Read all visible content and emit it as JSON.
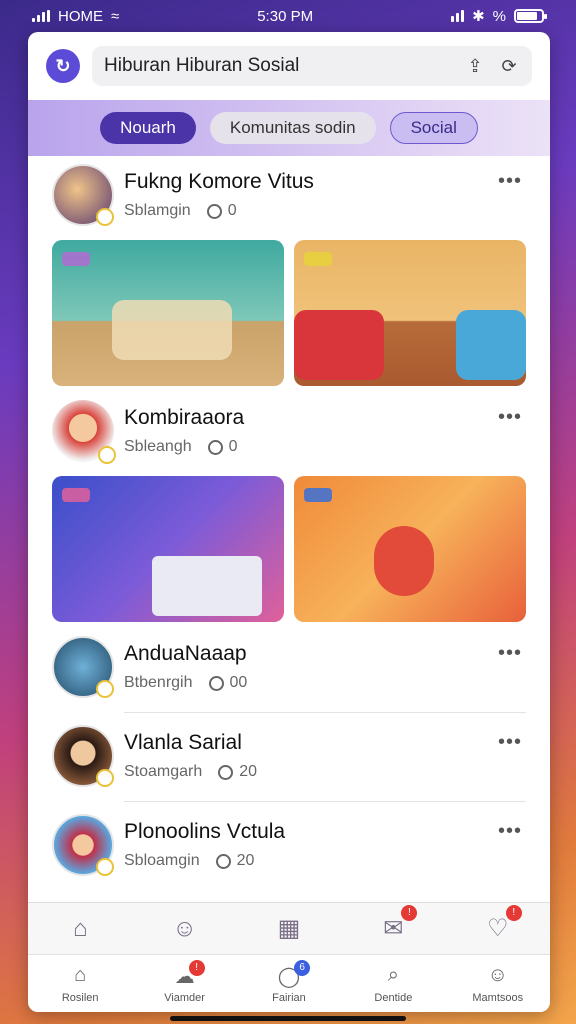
{
  "status": {
    "carrier": "HOME",
    "time": "5:30 PM",
    "battery_icon": "battery-icon"
  },
  "top_bar": {
    "title": "Hiburan Hiburan Sosial"
  },
  "tabs": [
    {
      "label": "Nouarh"
    },
    {
      "label": "Komunitas sodin"
    },
    {
      "label": "Social"
    }
  ],
  "posts": [
    {
      "name": "Fukng Komore Vitus",
      "sub": "Sblamgin",
      "count": "0"
    },
    {
      "name": "Kombiraaora",
      "sub": "Sbleangh",
      "count": "0"
    },
    {
      "name": "AnduaNaaap",
      "sub": "Btbenrgih",
      "count": "00"
    },
    {
      "name": "Vlanla Sarial",
      "sub": "Stoamgarh",
      "count": "20"
    },
    {
      "name": "Plonoolins Vctula",
      "sub": "Sbloamgin",
      "count": "20"
    }
  ],
  "bottom_nav": [
    {
      "label": "Rosilen"
    },
    {
      "label": "Viamder"
    },
    {
      "label": "Fairian",
      "badge": "6"
    },
    {
      "label": "Dentide"
    },
    {
      "label": "Mamtsoos"
    }
  ],
  "badges": {
    "icon2": "!",
    "icon3": "!",
    "icon4": "!",
    "nav2": "!"
  },
  "colors": {
    "accent": "#4b34a8",
    "badge": "#e53935"
  }
}
